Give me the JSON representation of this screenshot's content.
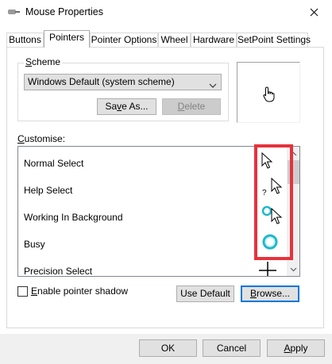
{
  "window": {
    "title": "Mouse Properties",
    "icon": "mouse-icon",
    "close_icon": "close-icon"
  },
  "tabs": [
    {
      "label": "Buttons",
      "active": false
    },
    {
      "label": "Pointers",
      "active": true
    },
    {
      "label": "Pointer Options",
      "active": false
    },
    {
      "label": "Wheel",
      "active": false
    },
    {
      "label": "Hardware",
      "active": false
    },
    {
      "label": "SetPoint Settings",
      "active": false
    }
  ],
  "scheme": {
    "group_label": "Scheme",
    "group_label_accel": "S",
    "group_label_rest": "cheme",
    "selected": "Windows Default (system scheme)",
    "save_as": "Save As...",
    "save_as_accel": "v",
    "delete": "Delete",
    "delete_accel": "D",
    "delete_rest": "elete"
  },
  "preview_icon": "hand-pointer-icon",
  "customise": {
    "label": "Customise:",
    "label_accel": "C",
    "label_rest": "ustomise:",
    "items": [
      {
        "label": "Normal Select",
        "icon": "arrow-cursor-icon"
      },
      {
        "label": "Help Select",
        "icon": "help-cursor-icon"
      },
      {
        "label": "Working In Background",
        "icon": "working-cursor-icon"
      },
      {
        "label": "Busy",
        "icon": "busy-cursor-icon"
      },
      {
        "label": "Precision Select",
        "icon": "crosshair-cursor-icon"
      }
    ]
  },
  "shadow": {
    "label": "Enable pointer shadow",
    "label_accel": "E",
    "label_rest": "nable pointer shadow",
    "checked": false
  },
  "use_default": "Use Default",
  "browse": "Browse...",
  "browse_accel": "B",
  "browse_rest": "rowse...",
  "footer": {
    "ok": "OK",
    "cancel": "Cancel",
    "apply": "Apply",
    "apply_accel": "A",
    "apply_rest": "pply"
  },
  "colors": {
    "highlight": "#e6323c",
    "focus": "#0078d7",
    "busy_ring": "#1fb8c9"
  }
}
